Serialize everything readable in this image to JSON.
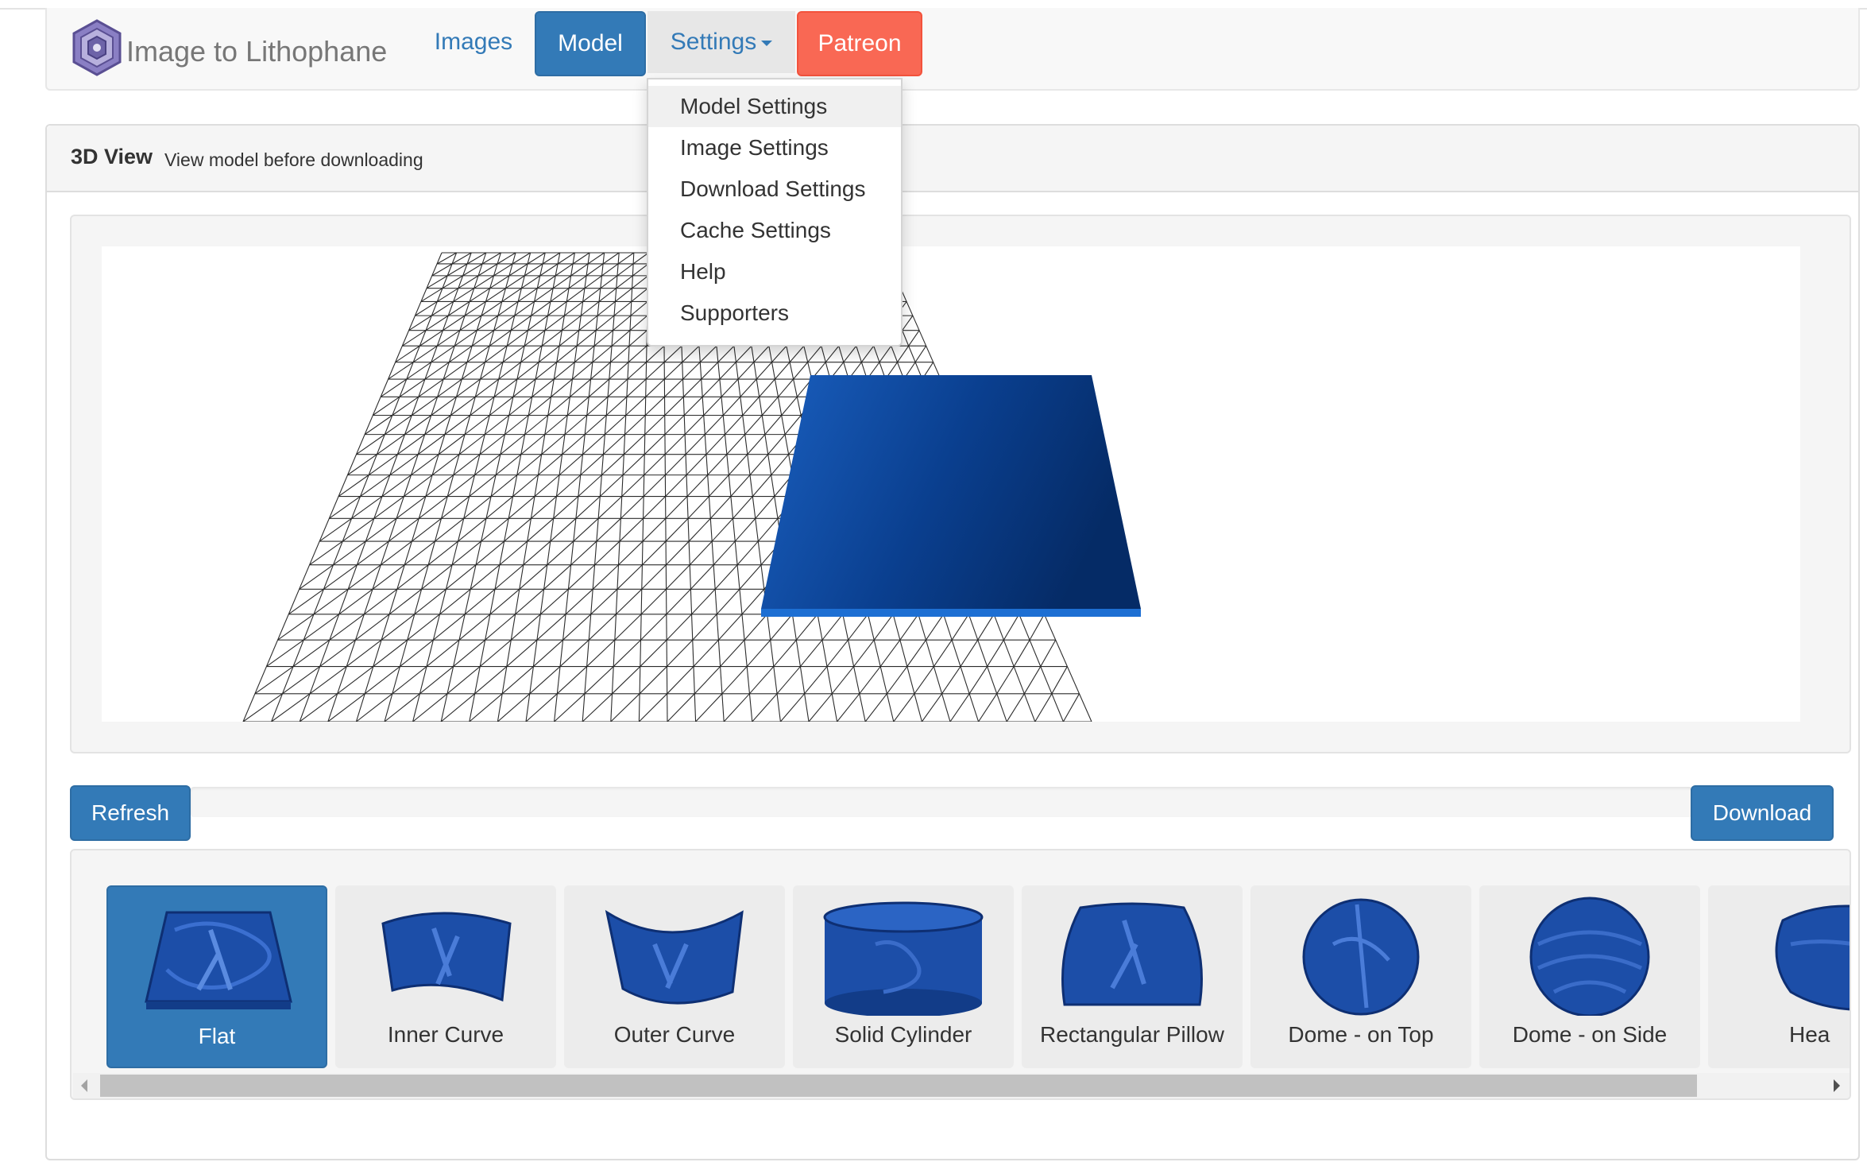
{
  "brand": {
    "title": "Image to Lithophane"
  },
  "nav": {
    "images": "Images",
    "model": "Model",
    "settings": "Settings",
    "patreon": "Patreon"
  },
  "dropdown": {
    "items": [
      "Model Settings",
      "Image Settings",
      "Download Settings",
      "Cache Settings",
      "Help",
      "Supporters"
    ]
  },
  "panel": {
    "title": "3D View",
    "subtitle": "View model before downloading"
  },
  "buttons": {
    "refresh": "Refresh",
    "download": "Download"
  },
  "shapes": [
    "Flat",
    "Inner Curve",
    "Outer Curve",
    "Solid Cylinder",
    "Rectangular Pillow",
    "Dome - on Top",
    "Dome - on Side",
    "Hea"
  ],
  "colors": {
    "primary": "#337ab7",
    "patreon": "#f96854",
    "model_blue": "#0b3f8c"
  }
}
